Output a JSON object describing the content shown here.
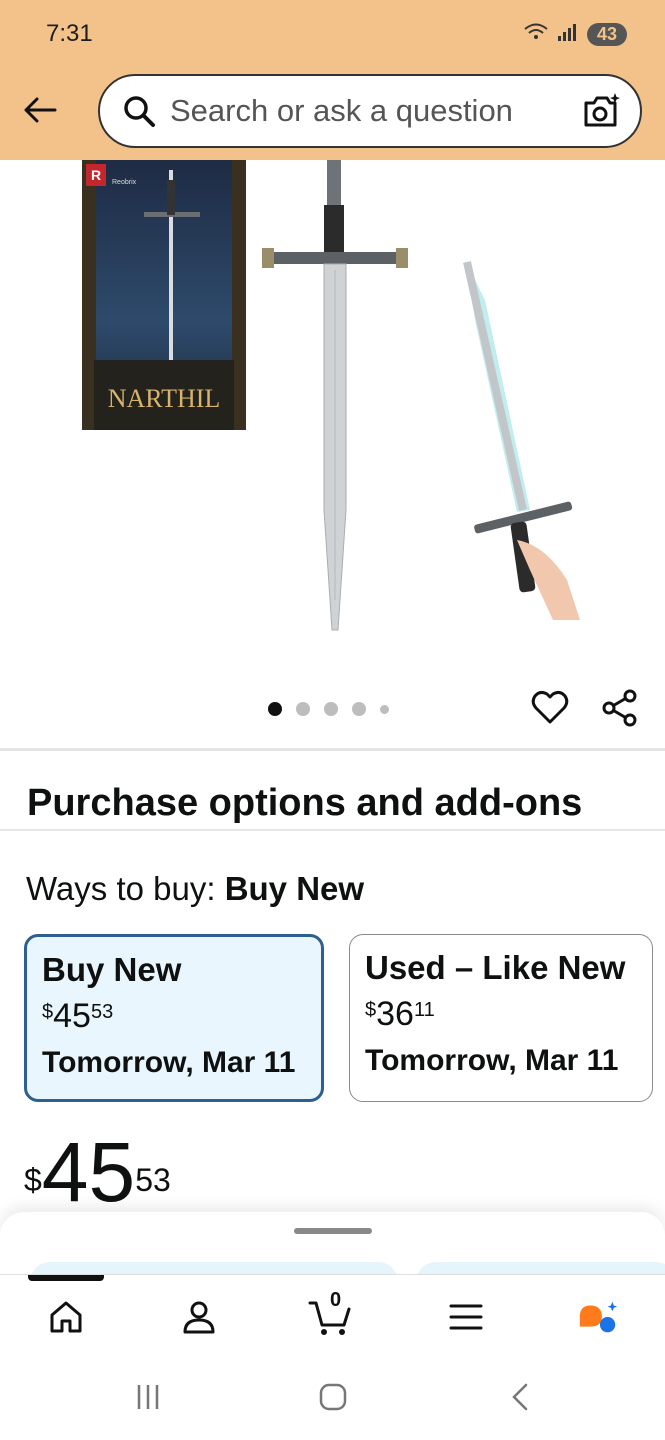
{
  "status_bar": {
    "time": "7:31",
    "battery": "43"
  },
  "search": {
    "placeholder": "Search or ask a question"
  },
  "product": {
    "image_box_brand": "Reobrix",
    "image_box_title": "NARTHIL",
    "carousel": {
      "count": 5,
      "active_index": 0
    }
  },
  "purchase": {
    "section_title": "Purchase options and add-ons",
    "ways_label": "Ways to buy:",
    "ways_selected": "Buy New",
    "options": [
      {
        "title": "Buy New",
        "currency": "$",
        "dollars": "45",
        "cents": "53",
        "delivery": "Tomorrow, Mar 11",
        "selected": true
      },
      {
        "title": "Used – Like New",
        "currency": "$",
        "dollars": "36",
        "cents": "11",
        "delivery": "Tomorrow, Mar 11",
        "selected": false
      }
    ],
    "price": {
      "currency": "$",
      "dollars": "45",
      "cents": "53"
    }
  },
  "nav": {
    "cart_count": "0"
  },
  "colors": {
    "header": "#f3c28a",
    "selected_border": "#2d5f8f",
    "selected_bg": "#eaf6fd",
    "rufus_orange": "#ff7a1a",
    "rufus_blue": "#1a73e8"
  }
}
